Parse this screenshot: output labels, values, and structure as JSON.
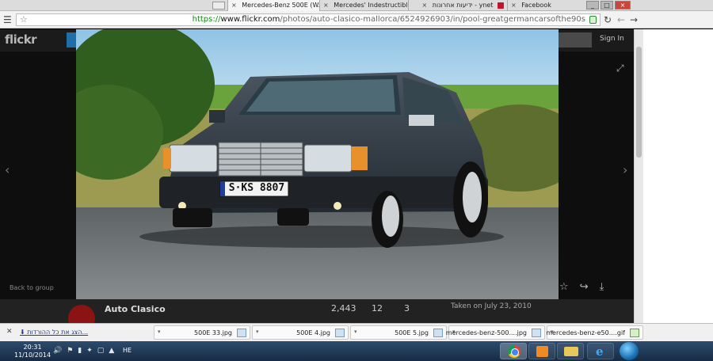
{
  "tabs": [
    {
      "title": "Mercedes-Benz 500E (W..."
    },
    {
      "title": "Mercedes' Indestructible"
    },
    {
      "title": "ynet - ידיעות אחרונות"
    },
    {
      "title": "Facebook"
    }
  ],
  "address": {
    "scheme": "https://",
    "host": "www.flickr.com",
    "path": "/photos/auto-clasico-mallorca/6524926903/in/pool-greatgermancarsofthe90s"
  },
  "flickr": {
    "logo": "flickr",
    "sign_in": "Sign In",
    "back_to_group": "Back to group",
    "owner_name": "Auto Clasico",
    "stats": [
      "2,443",
      "12",
      "3"
    ],
    "taken": "Taken on July 23, 2010",
    "plate": "S·KS 8807"
  },
  "downloads": {
    "show_all": "הצג את כל ההורדות...",
    "items": [
      {
        "name": "500E 33.jpg"
      },
      {
        "name": "500E 4.jpg"
      },
      {
        "name": "500E 5.jpg"
      },
      {
        "name": "mercedes-benz-500....jpg"
      },
      {
        "name": "mercedes-benz-e50....gif"
      }
    ]
  },
  "taskbar": {
    "time": "20:31",
    "date": "11/10/2014",
    "lang": "HE"
  },
  "icons": {
    "menu": "hamburger-menu-icon",
    "star": "bookmark-star-icon",
    "reload": "reload-icon",
    "back": "back-arrow-icon",
    "forward": "forward-arrow-icon"
  },
  "colors": {
    "secure_green": "#148a14",
    "flickr_bg": "#0e0e0e",
    "taskbar": "#1d3553"
  }
}
